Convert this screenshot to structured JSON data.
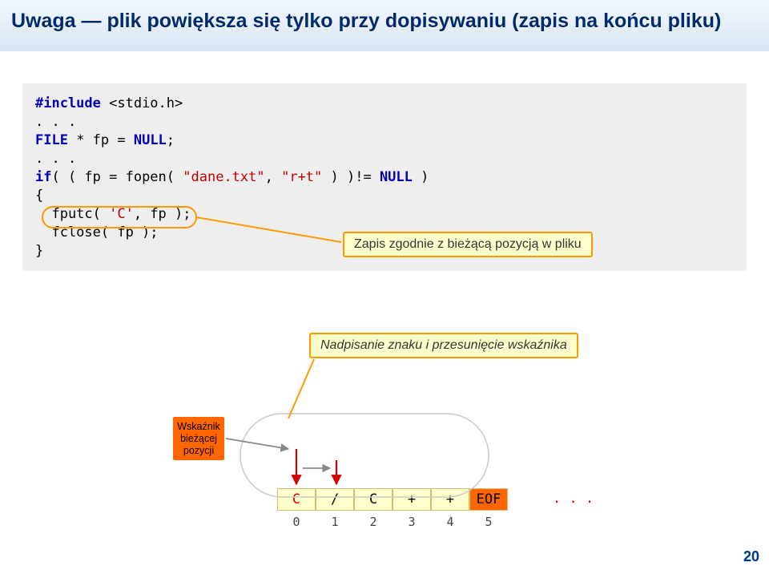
{
  "title": "Uwaga — plik powiększa się tylko przy dopisywaniu (zapis na końcu pliku)",
  "code": {
    "l1a": "#include",
    "l1b": " <stdio.h>",
    "l2": ". . .",
    "l3a": "FILE",
    "l3b": " * fp = ",
    "l3c": "NULL",
    "l3d": ";",
    "l4": ". . .",
    "l5a": "if",
    "l5b": "( ( fp = fopen( ",
    "l5c": "\"dane.txt\"",
    "l5d": ", ",
    "l5e": "\"r+t\"",
    "l5f": " ) )!= ",
    "l5g": "NULL",
    "l5h": " )",
    "l6": "{",
    "l7a": "  fputc( ",
    "l7b": "'C'",
    "l7c": ", fp );",
    "l8": "",
    "l9": "  fclose( fp );",
    "l10": "}"
  },
  "callout1": "Zapis zgodnie z bieżącą pozycją w pliku",
  "callout2": "Nadpisanie znaku i przesunięcie wskaźnika",
  "ptr_l1": "Wskaźnik",
  "ptr_l2": "bieżącej",
  "ptr_l3": "pozycji",
  "tape": [
    "C",
    "/",
    "C",
    "+",
    "+",
    "EOF"
  ],
  "indices": [
    "0",
    "1",
    "2",
    "3",
    "4",
    "5"
  ],
  "dots": ". . .",
  "pagenum": "20"
}
